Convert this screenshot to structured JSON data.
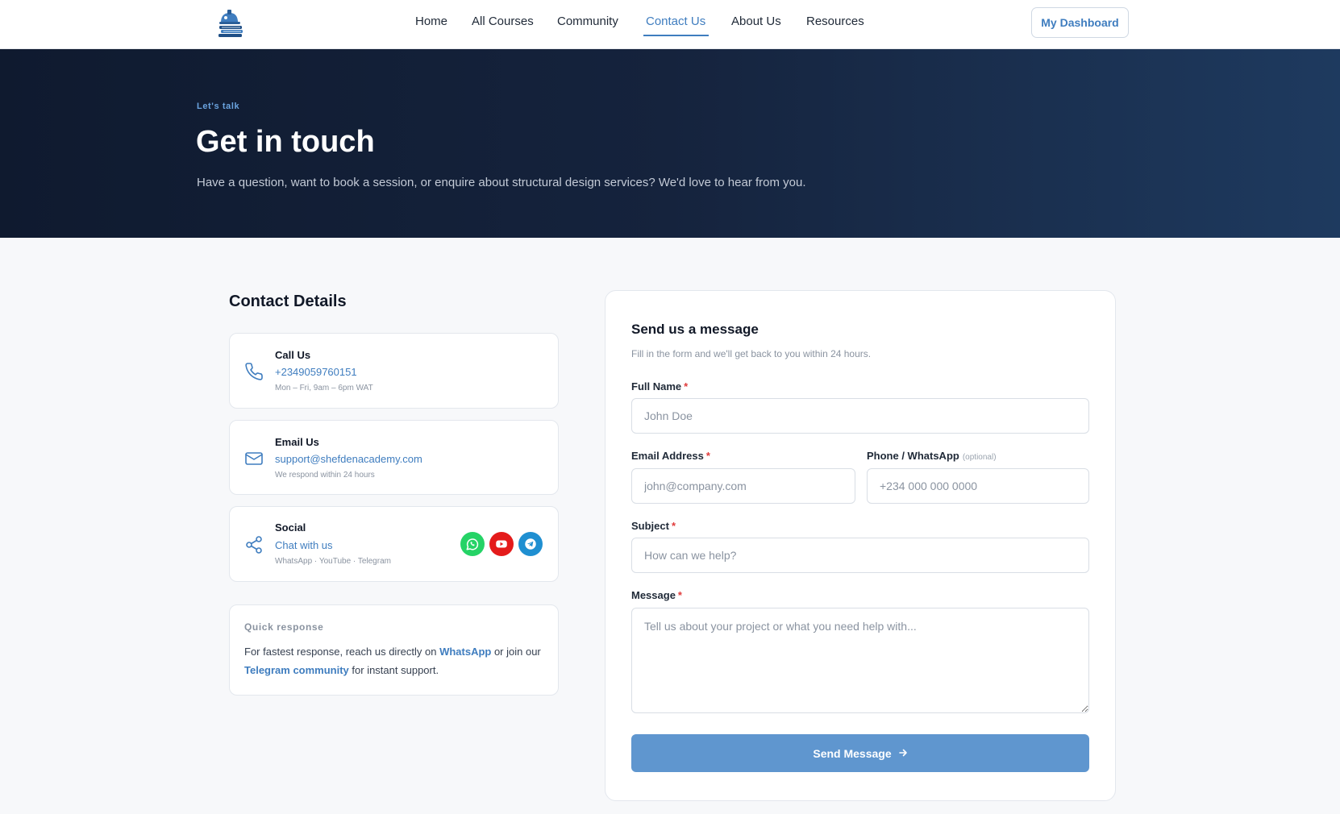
{
  "header": {
    "nav": [
      {
        "label": "Home"
      },
      {
        "label": "All Courses"
      },
      {
        "label": "Community"
      },
      {
        "label": "Contact Us",
        "active": true
      },
      {
        "label": "About Us"
      },
      {
        "label": "Resources"
      }
    ],
    "dashboard_label": "My Dashboard"
  },
  "hero": {
    "eyebrow": "Let's talk",
    "title": "Get in touch",
    "subtitle": "Have a question, want to book a session, or enquire about structural design services? We'd love to hear from you."
  },
  "contact": {
    "title": "Contact Details",
    "call": {
      "heading": "Call Us",
      "value": "+2349059760151",
      "note": "Mon – Fri, 9am – 6pm WAT",
      "icon": "phone-icon"
    },
    "email": {
      "heading": "Email Us",
      "value": "support@shefdenacademy.com",
      "note": "We respond within 24 hours",
      "icon": "mail-icon"
    },
    "social": {
      "heading": "Social",
      "value": "Chat with us",
      "note": "WhatsApp · YouTube · Telegram",
      "icon": "share-icon"
    },
    "quick": {
      "title": "Quick response",
      "text_1": "For fastest response, reach us directly on ",
      "link_1": "WhatsApp",
      "text_2": " or join our ",
      "link_2": "Telegram community",
      "text_3": " for instant support."
    }
  },
  "form": {
    "title": "Send us a message",
    "subtitle": "Fill in the form and we'll get back to you within 24 hours.",
    "full_name": {
      "label": "Full Name",
      "required": "*",
      "placeholder": "John Doe"
    },
    "email": {
      "label": "Email Address",
      "required": "*",
      "placeholder": "john@company.com"
    },
    "phone": {
      "label": "Phone / WhatsApp",
      "optional": "(optional)",
      "placeholder": "+234 000 000 0000"
    },
    "subject": {
      "label": "Subject",
      "required": "*",
      "placeholder": "How can we help?"
    },
    "message": {
      "label": "Message",
      "required": "*",
      "placeholder": "Tell us about your project or what you need help with..."
    },
    "submit_label": "Send Message"
  },
  "colors": {
    "accent": "#3f7dbf",
    "button": "#5f96cf",
    "whatsapp": "#25d366",
    "youtube": "#ff0000",
    "telegram": "#229ed9",
    "hero_dark": "#0f1a2f"
  }
}
